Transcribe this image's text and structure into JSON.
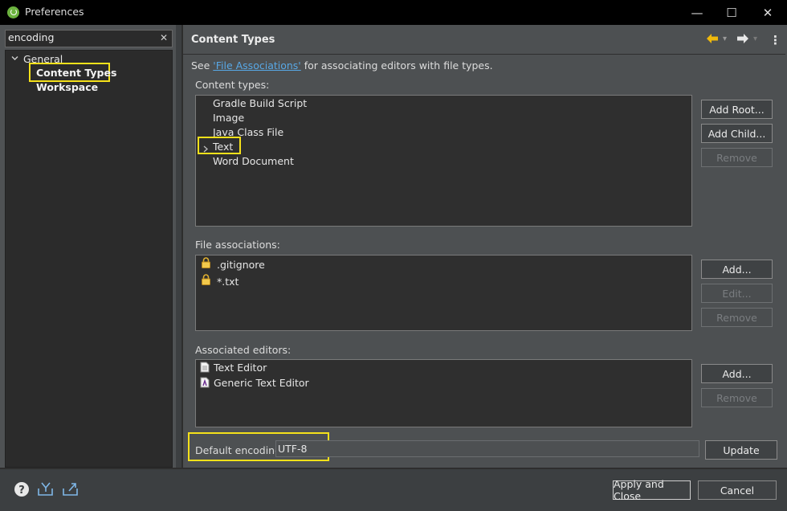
{
  "window": {
    "title": "Preferences",
    "minimize": "—",
    "maximize": "☐",
    "close": "✕"
  },
  "filter": {
    "value": "encoding",
    "clear": "✕"
  },
  "tree": {
    "general": "General",
    "content_types": "Content Types",
    "workspace": "Workspace"
  },
  "page": {
    "title": "Content Types",
    "see_prefix": "See ",
    "see_link": "'File Associations'",
    "see_suffix": " for associating editors with file types.",
    "back_glyph": "🡄",
    "forward_glyph": "🡆",
    "dropdown": "▾",
    "menu": "⋮"
  },
  "content_types": {
    "label": "Content types:",
    "items": [
      "Gradle Build Script",
      "Image",
      "Java Class File",
      "Text",
      "Word Document"
    ],
    "add_root": "Add Root...",
    "add_child": "Add Child...",
    "remove": "Remove"
  },
  "file_associations": {
    "label": "File associations:",
    "items": [
      ".gitignore",
      "*.txt"
    ],
    "add": "Add...",
    "edit": "Edit...",
    "remove": "Remove"
  },
  "associated_editors": {
    "label": "Associated editors:",
    "items": [
      "Text Editor",
      "Generic Text Editor"
    ],
    "add": "Add...",
    "remove": "Remove"
  },
  "encoding": {
    "label": "Default encoding:",
    "value": "UTF-8",
    "update": "Update"
  },
  "footer": {
    "apply_close": "Apply and Close",
    "cancel": "Cancel"
  },
  "colors": {
    "highlight": "#f5e11a",
    "link": "#58a8e6",
    "arrow": "#f0b90b"
  }
}
